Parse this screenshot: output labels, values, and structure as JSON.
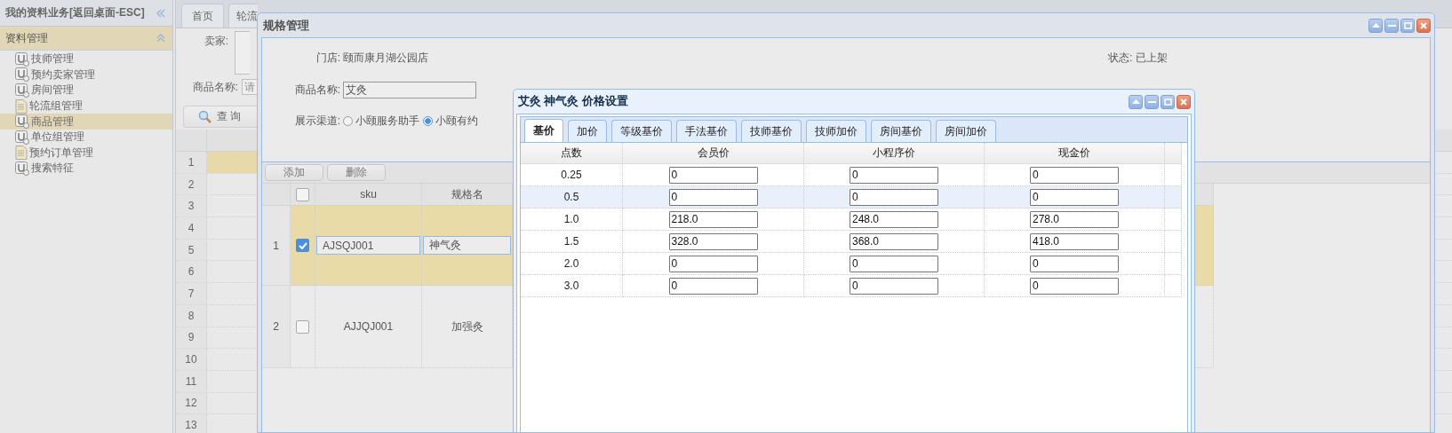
{
  "sidebar": {
    "title": "我的资料业务[返回桌面-ESC]",
    "section": {
      "label": "资料管理",
      "expanded": true
    },
    "items": [
      {
        "label": "技师管理",
        "kind": "module",
        "selected": false
      },
      {
        "label": "预约卖家管理",
        "kind": "module",
        "selected": false
      },
      {
        "label": "房间管理",
        "kind": "module",
        "selected": false
      },
      {
        "label": "轮流组管理",
        "kind": "doc",
        "selected": false
      },
      {
        "label": "商品管理",
        "kind": "module",
        "selected": true
      },
      {
        "label": "单位组管理",
        "kind": "module",
        "selected": false
      },
      {
        "label": "预约订单管理",
        "kind": "doc",
        "selected": false
      },
      {
        "label": "搜索特征",
        "kind": "module",
        "selected": false
      }
    ]
  },
  "main": {
    "tabs": [
      {
        "label": "首页"
      },
      {
        "label": "轮流"
      }
    ],
    "seller_label": "卖家:",
    "name_label": "商品名称:",
    "name_placeholder": "请",
    "query_button": "查 询",
    "grid_rows": [
      {
        "number": "1",
        "selected": true
      },
      {
        "number": "2",
        "selected": false
      },
      {
        "number": "3",
        "selected": false
      },
      {
        "number": "4",
        "selected": false
      },
      {
        "number": "5",
        "selected": false
      },
      {
        "number": "6",
        "selected": false
      },
      {
        "number": "7",
        "selected": false
      },
      {
        "number": "8",
        "selected": false
      },
      {
        "number": "9",
        "selected": false
      },
      {
        "number": "10",
        "selected": false
      },
      {
        "number": "11",
        "selected": false
      },
      {
        "number": "12",
        "selected": false
      },
      {
        "number": "13",
        "selected": false
      }
    ]
  },
  "spec_window": {
    "title": "规格管理",
    "store_label": "门店:",
    "store": "颐而康月湖公园店",
    "status_label": "状态:",
    "status": "已上架",
    "name_label": "商品名称:",
    "name_value": "艾灸",
    "channel_label": "展示渠道:",
    "channels": [
      {
        "label": "小颐服务助手",
        "selected": false
      },
      {
        "label": "小颐有约",
        "selected": true
      }
    ],
    "toolbar": [
      "添加",
      "删除"
    ],
    "header_checked": false,
    "columns": [
      "sku",
      "规格名"
    ],
    "rows": [
      {
        "number": "1",
        "checked": true,
        "selected": true,
        "editing": true,
        "sku": "AJSQJ001",
        "name": "神气灸"
      },
      {
        "number": "2",
        "checked": false,
        "selected": false,
        "editing": false,
        "sku": "AJJQJ001",
        "name": "加强灸"
      }
    ]
  },
  "price_dialog": {
    "title": "艾灸 神气灸 价格设置",
    "tabs": [
      {
        "label": "基价",
        "selected": true
      },
      {
        "label": "加价",
        "selected": false
      },
      {
        "label": "等级基价",
        "selected": false
      },
      {
        "label": "手法基价",
        "selected": false
      },
      {
        "label": "技师基价",
        "selected": false
      },
      {
        "label": "技师加价",
        "selected": false
      },
      {
        "label": "房间基价",
        "selected": false
      },
      {
        "label": "房间加价",
        "selected": false
      }
    ],
    "columns": [
      "点数",
      "会员价",
      "小程序价",
      "现金价"
    ],
    "rows": [
      {
        "points": "0.25",
        "selected": false,
        "values": [
          "0",
          "0",
          "0"
        ]
      },
      {
        "points": "0.5",
        "selected": true,
        "values": [
          "0",
          "0",
          "0"
        ]
      },
      {
        "points": "1.0",
        "selected": false,
        "values": [
          "218.0",
          "248.0",
          "278.0"
        ]
      },
      {
        "points": "1.5",
        "selected": false,
        "values": [
          "328.0",
          "368.0",
          "418.0"
        ]
      },
      {
        "points": "2.0",
        "selected": false,
        "values": [
          "0",
          "0",
          "0"
        ]
      },
      {
        "points": "3.0",
        "selected": false,
        "values": [
          "0",
          "0",
          "0"
        ]
      }
    ]
  }
}
